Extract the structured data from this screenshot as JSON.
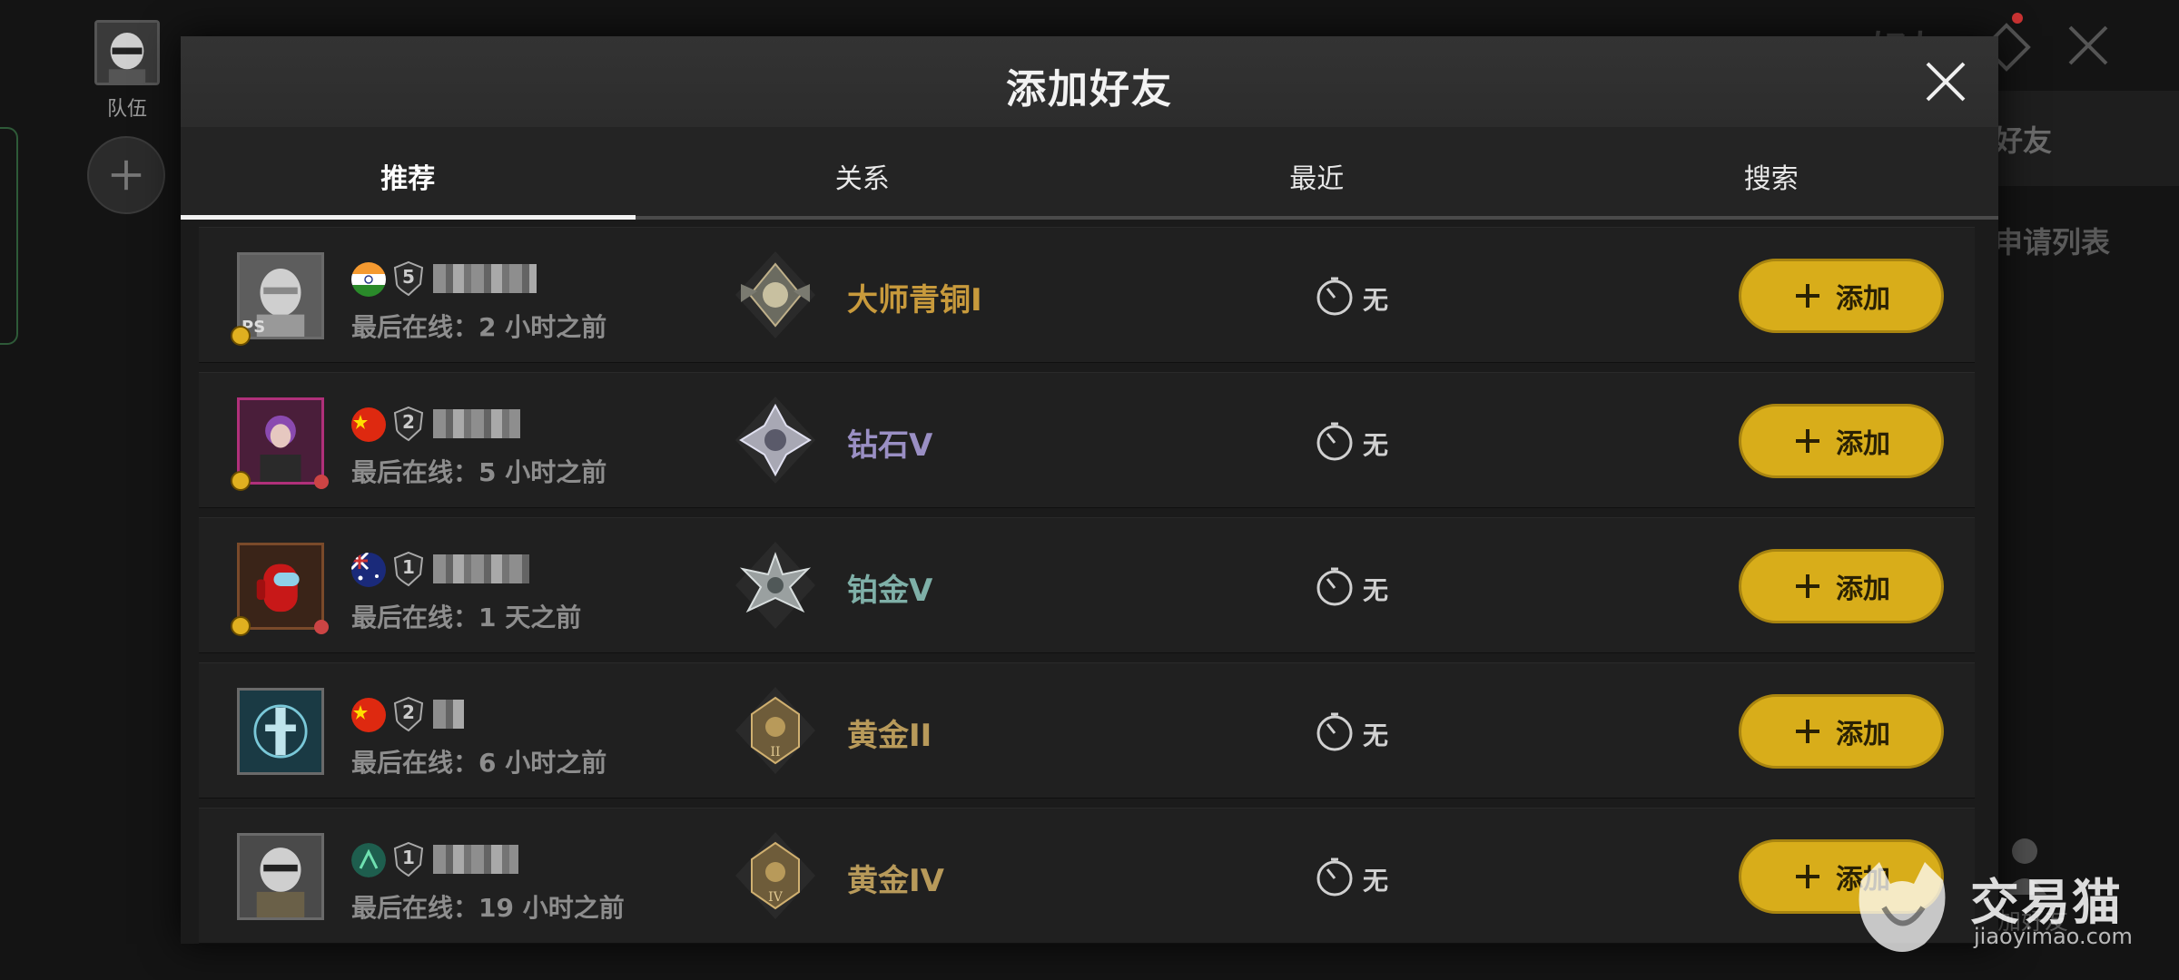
{
  "background": {
    "team_label": "队伍",
    "right_title": "好友",
    "panel_title": "好友",
    "panel_sub": "申请列表",
    "person_label": "加好友"
  },
  "dialog": {
    "title": "添加好友"
  },
  "tabs": [
    {
      "label": "推荐",
      "active": true
    },
    {
      "label": "关系",
      "active": false
    },
    {
      "label": "最近",
      "active": false
    },
    {
      "label": "搜索",
      "active": false
    }
  ],
  "rows": [
    {
      "flag": "india",
      "level": "5",
      "last_online": "最后在线：2 小时之前",
      "rank": "大师青铜I",
      "rank_color": "#c89a3c",
      "timer_label": "无",
      "add_label": "添加"
    },
    {
      "flag": "china",
      "level": "2",
      "last_online": "最后在线：5 小时之前",
      "rank": "钻石V",
      "rank_color": "#9a8fc4",
      "timer_label": "无",
      "add_label": "添加"
    },
    {
      "flag": "australia",
      "level": "1",
      "last_online": "最后在线：1 天之前",
      "rank": "铂金V",
      "rank_color": "#7fb0a8",
      "timer_label": "无",
      "add_label": "添加"
    },
    {
      "flag": "china",
      "level": "2",
      "last_online": "最后在线：6 小时之前",
      "rank": "黄金II",
      "rank_color": "#b89a5a",
      "timer_label": "无",
      "add_label": "添加"
    },
    {
      "flag": "unknown",
      "level": "1",
      "last_online": "最后在线：19 小时之前",
      "rank": "黄金IV",
      "rank_color": "#b89a5a",
      "timer_label": "无",
      "add_label": "添加"
    }
  ],
  "watermark": {
    "brand": "交易猫",
    "url": "jiaoyimao.com"
  },
  "colors": {
    "accent_button": "#d8ad1a",
    "dialog_bg": "#1b1b1b"
  }
}
